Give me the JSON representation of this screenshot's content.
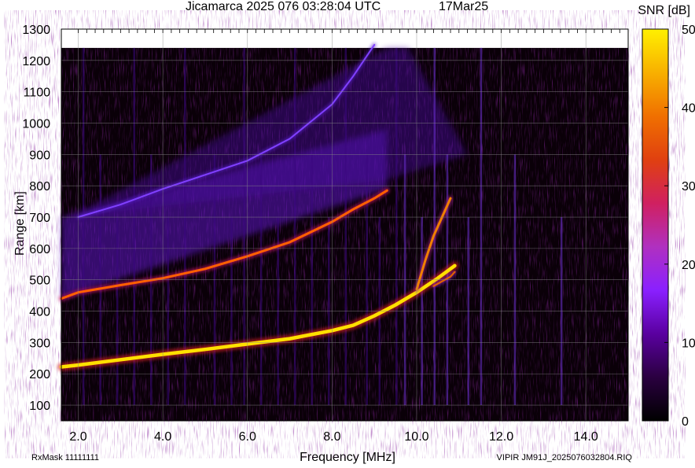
{
  "header": {
    "title": "Jicamarca 2025 076 03:28:04 UTC",
    "date": "17Mar25"
  },
  "footer": {
    "rxmask": "RxMask 11111111",
    "file": "VIPIR  JM91J_2025076032804.RIQ"
  },
  "colorbar": {
    "label": "SNR [dB]",
    "ticks": [
      "50",
      "40",
      "30",
      "20",
      "10",
      "0"
    ],
    "range": [
      0,
      50
    ],
    "colors": [
      "#000000",
      "#2a0040",
      "#5a00a0",
      "#8a20ff",
      "#b030c0",
      "#d02060",
      "#e04010",
      "#f07000",
      "#f8b000",
      "#fff000"
    ]
  },
  "chart_data": {
    "type": "heatmap",
    "title": "Jicamarca 2025 076 03:28:04 UTC",
    "xlabel": "Frequency [MHz]",
    "ylabel": "Range [km]",
    "xlim": [
      1.6,
      15.0
    ],
    "ylim": [
      50,
      1300
    ],
    "x_ticks": [
      "2.0",
      "4.0",
      "6.0",
      "8.0",
      "10.0",
      "12.0",
      "14.0"
    ],
    "y_ticks": [
      "100",
      "200",
      "300",
      "400",
      "500",
      "600",
      "700",
      "800",
      "900",
      "1000",
      "1100",
      "1200",
      "1300"
    ],
    "grid": true,
    "traces": [
      {
        "name": "",
        "x": [
          1.6,
          2.0,
          3.0,
          4.0,
          5.0,
          6.0,
          7.0,
          8.0,
          8.5,
          9.0,
          9.5,
          10.0,
          10.5,
          10.9
        ],
        "y": [
          222,
          228,
          245,
          262,
          278,
          295,
          312,
          338,
          355,
          385,
          420,
          460,
          505,
          545
        ]
      },
      {
        "name": "",
        "x": [
          1.6,
          2.0,
          3.0,
          4.0,
          5.0,
          6.0,
          7.0,
          8.0,
          8.5,
          9.0,
          9.3
        ],
        "y": [
          440,
          460,
          483,
          505,
          535,
          575,
          620,
          685,
          725,
          760,
          785
        ]
      },
      {
        "name": "",
        "x": [
          10.0,
          10.2,
          10.4,
          10.6,
          10.8
        ],
        "y": [
          470,
          560,
          640,
          700,
          760
        ]
      },
      {
        "name": "",
        "x": [
          10.4,
          10.6,
          10.8,
          10.9
        ],
        "y": [
          480,
          495,
          510,
          525
        ]
      },
      {
        "name": "",
        "x": [
          2.0,
          3.0,
          4.0,
          5.0,
          6.0,
          7.0,
          8.0,
          8.5,
          9.0
        ],
        "y": [
          700,
          740,
          790,
          835,
          880,
          950,
          1060,
          1150,
          1250
        ]
      }
    ],
    "colorbar_label": "SNR [dB]",
    "colorbar_range": [
      0,
      50
    ]
  }
}
